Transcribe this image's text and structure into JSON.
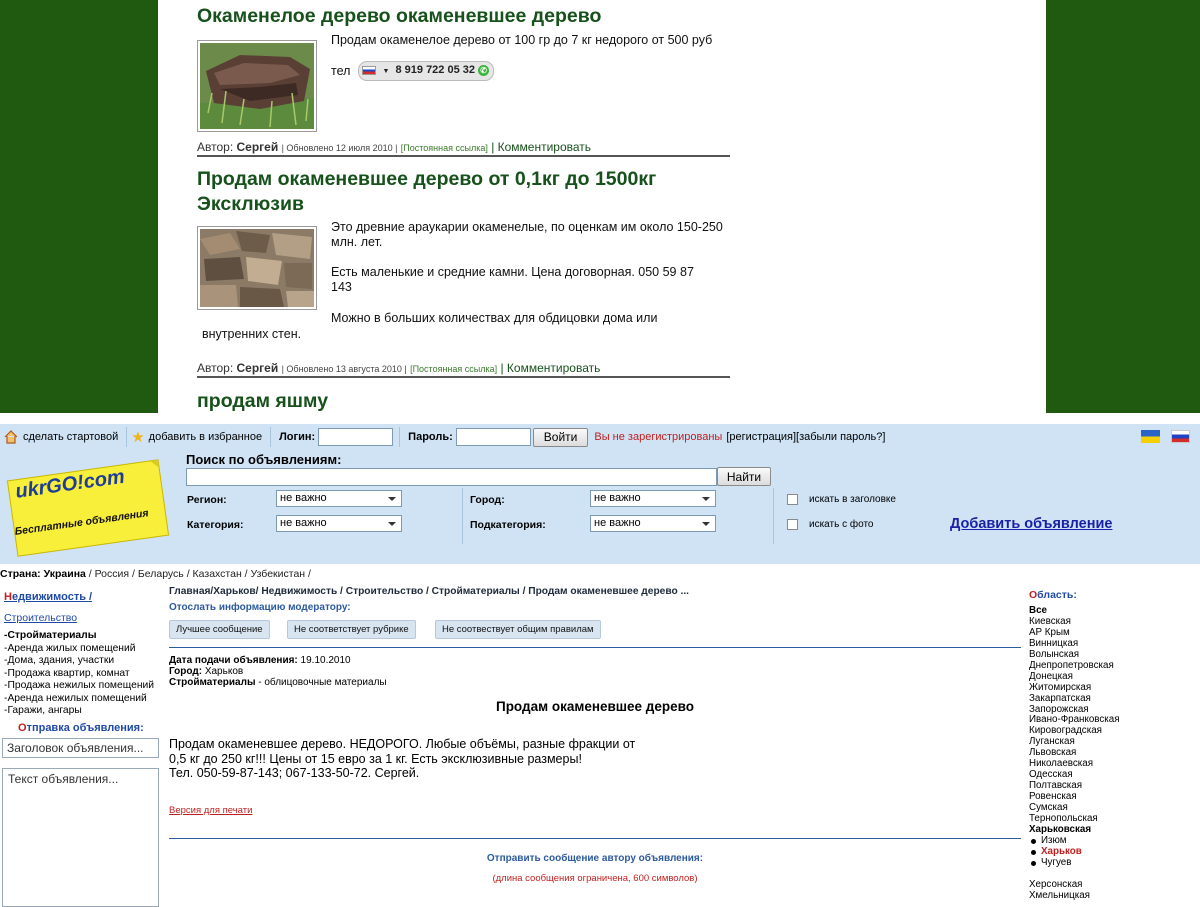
{
  "posts": [
    {
      "title_lines": [
        "Окаменелое дерево окаменевшее дерево"
      ],
      "text": "Продам окаменелое дерево от 100 гр до 7 кг недорого от 500 руб",
      "phone_prefix": "тел",
      "phone": "8 919 722 05 32",
      "author_label": "Автор:",
      "author": "Сергей",
      "updated": "| Обновлено 12 июля 2010 |",
      "permalink": "[Постоянная ссылка]",
      "comment": "| Комментировать"
    },
    {
      "title_lines": [
        "Продам окаменевшее дерево от 0,1кг до 1500кг",
        "Эксклюзив"
      ],
      "text1_l1": "Это древние араукарии окаменелые, по оценкам им около 150-250",
      "text1_l2": "млн. лет.",
      "text2_l1": "Есть маленькие и средние камни. Цена договорная.  050 59 87",
      "text2_l2": "143",
      "text3_l1": "Можно в больших количествах для обдицовки дома или",
      "text3_l2": "внутренних стен.",
      "author_label": "Автор:",
      "author": "Сергей",
      "updated": "| Обновлено 13 августа 2010 |",
      "permalink": "[Постоянная ссылка]",
      "comment": "| Комментировать"
    },
    {
      "title_lines": [
        "продам яшму"
      ]
    }
  ],
  "toolbar": {
    "home": "сделать стартовой",
    "fav": "добавить в избранное",
    "login_label": "Логин:",
    "password_label": "Пароль:",
    "login_btn": "Войти",
    "not_registered": "Вы не зарегистрированы",
    "register": "[регистрация]",
    "forgot": "[забыли пароль?]"
  },
  "logo": {
    "text": "ukrGO!com",
    "tagline": "Бесплатные объявления",
    "color": "#f8ef3a"
  },
  "search": {
    "title": "Поиск по объявлениям:",
    "button": "Найти",
    "region_label": "Регион:",
    "region_value": "не важно",
    "city_label": "Город:",
    "city_value": "не важно",
    "category_label": "Категория:",
    "category_value": "не важно",
    "subcategory_label": "Подкатегория:",
    "subcategory_value": "не важно",
    "in_title": "искать в заголовке",
    "with_photo": "искать с фото",
    "add_ad": "Добавить объявление"
  },
  "country": {
    "label": "Страна:",
    "items": [
      "Украина",
      "Россия",
      "Беларусь",
      "Казахстан",
      "Узбекистан"
    ]
  },
  "left": {
    "cat_initial": "Н",
    "cat_rest": "едвижимость /",
    "sub": "Строительство",
    "items": [
      "Стройматериалы",
      "Аренда жилых помещений",
      "Дома, здания, участки",
      "Продажа квартир, комнат",
      "Продажа нежилых помещений",
      "Аренда нежилых помещений",
      "Гаражи, ангары"
    ],
    "send_initial": "О",
    "send_rest": "тправка объявления:",
    "title_placeholder": "Заголовок объявления...",
    "text_placeholder": "Текст объявления..."
  },
  "main": {
    "breadcrumb": "Главная/Харьков/ Недвижимость / Строительство / Стройматериалы / Продам окаменевшее дерево ...",
    "mod_link": "Отослать информацию модератору:",
    "buttons": [
      "Лучшее сообщение",
      "Не соответствует рубрике",
      "Не соотвествует общим правилам"
    ],
    "date_label": "Дата подачи объявления:",
    "date": "19.10.2010",
    "city_label": "Город:",
    "city": "Харьков",
    "cat_label": "Стройматериалы",
    "cat_value": "- облицовочные материалы",
    "heading": "Продам окаменевшее дерево",
    "body1": "Продам окаменевшее дерево. НЕДОРОГО. Любые объёмы, разные фракции от",
    "body2": "0,5 кг до 250 кг!!! Цены от 15 евро за 1 кг. Есть эксклюзивные размеры!",
    "body3": "Тел. 050-59-87-143; 067-133-50-72. Сергей.",
    "print": "Версия для печати",
    "send_author": "Отправить сообщение автору объявления:",
    "limit": "(длина сообщения ограничена, 600 символов)"
  },
  "right": {
    "hdr_initial": "О",
    "hdr_rest": "бласть:",
    "regions_a": [
      "Все",
      "Киевская",
      "АР Крым",
      "Винницкая",
      "Волынская",
      "Днепропетровская",
      "Донецкая",
      "Житомирская",
      "Закарпатская",
      "Запорожская",
      "Ивано-Франковская",
      "Кировоградская",
      "Луганская",
      "Львовская",
      "Николаевская",
      "Одесская",
      "Полтавская",
      "Ровенская",
      "Сумская",
      "Тернопольская",
      "Харьковская"
    ],
    "cities": [
      "Изюм",
      "Харьков",
      "Чугуев"
    ],
    "regions_b": [
      "Херсонская",
      "Хмельницкая"
    ]
  }
}
